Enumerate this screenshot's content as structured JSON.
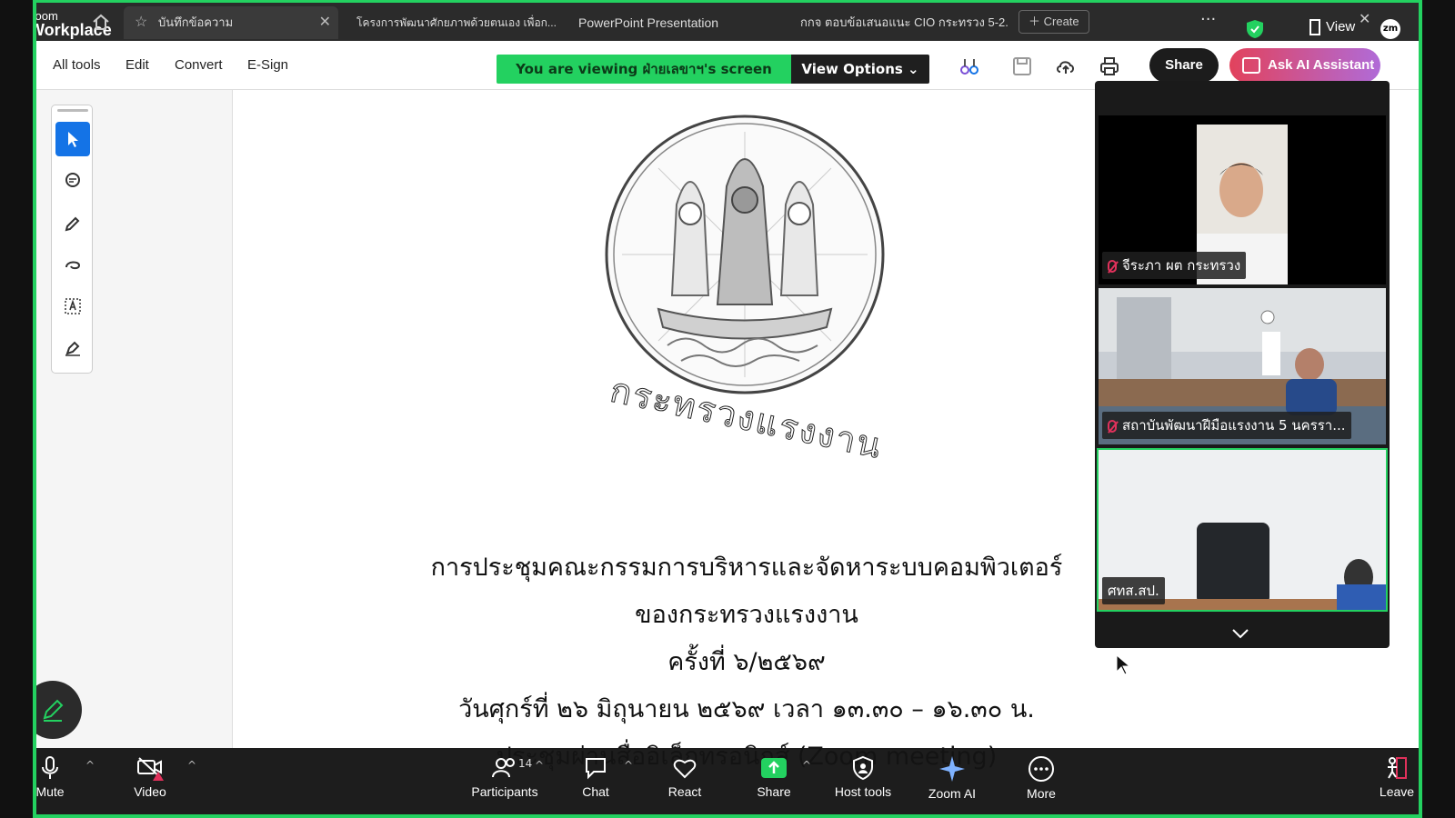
{
  "app": {
    "logo_top": "zoom",
    "logo_bottom": "Workplace"
  },
  "browser_tabs": [
    {
      "label": "บันทึกข้อความ"
    },
    {
      "label": "โครงการพัฒนาศักยภาพด้วยตนเอง เพื่อก..."
    },
    {
      "label": "PowerPoint Presentation"
    },
    {
      "label": "กกจ ตอบข้อเสนอแนะ CIO กระทรวง 5-2..."
    }
  ],
  "tabbar": {
    "create_label": "Create",
    "view_label": "View",
    "avatar": "zm"
  },
  "menu": {
    "all_tools": "All tools",
    "edit": "Edit",
    "convert": "Convert",
    "esign": "E-Sign"
  },
  "viewing": {
    "text": "You are viewing  ฝ่ายเลขาฯ's screen",
    "options": "View Options"
  },
  "toolbar": {
    "share": "Share",
    "ai": "Ask AI Assistant"
  },
  "document": {
    "ministry": "กระทรวงแรงงาน",
    "lines": [
      "การประชุมคณะกรรมการบริหารและจัดหาระบบคอมพิวเตอร์",
      "ของกระทรวงแรงงาน",
      "ครั้งที่ ๖/๒๕๖๙",
      "วันศุกร์ที่  ๒๖  มิถุนายน  ๒๕๖๙  เวลา ๑๓.๓๐ – ๑๖.๓๐ น.",
      "ประชุมผ่านสื่ออิเล็กทรอนิกส์ (Zoom meeting)"
    ]
  },
  "participants_video": [
    {
      "name": "จีระภา ผต กระทรวง",
      "muted": true
    },
    {
      "name": "สถาบันพัฒนาฝีมือแรงงาน 5 นครรา...",
      "muted": true
    },
    {
      "name": "ศทส.สป.",
      "muted": false
    }
  ],
  "bottom_bar": {
    "mute": "Mute",
    "video": "Video",
    "participants": "Participants",
    "participants_count": "14",
    "chat": "Chat",
    "react": "React",
    "share": "Share",
    "host_tools": "Host tools",
    "zoom_ai": "Zoom AI",
    "more": "More",
    "leave": "Leave"
  },
  "colors": {
    "zoom_green": "#23d160",
    "acrobat_blue": "#1473e6",
    "leave_red": "#e0315b"
  }
}
